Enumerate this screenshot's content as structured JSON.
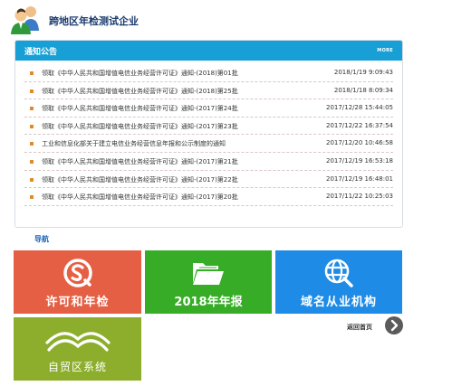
{
  "header": {
    "title": "跨地区年检测试企业",
    "user_icon": "user-group-icon"
  },
  "notice": {
    "title": "通知公告",
    "more_label": "MORE",
    "accent_color": "#18a0d6",
    "bullet_color": "#e08a2a",
    "items": [
      {
        "text": "领取《中华人民共和国增值电信业务经营许可证》通知-(2018)第01批",
        "date": "2018/1/19 9:09:43"
      },
      {
        "text": "领取《中华人民共和国增值电信业务经营许可证》通知-(2018)第25批",
        "date": "2018/1/18 8:09:34"
      },
      {
        "text": "领取《中华人民共和国增值电信业务经营许可证》通知-(2017)第24批",
        "date": "2017/12/28 15:44:05"
      },
      {
        "text": "领取《中华人民共和国增值电信业务经营许可证》通知-(2017)第23批",
        "date": "2017/12/22 16:37:54"
      },
      {
        "text": "工业和信息化部关于建立电信业务经营信息年报和公示制度的通知",
        "date": "2017/12/20 10:46:58"
      },
      {
        "text": "领取《中华人民共和国增值电信业务经营许可证》通知-(2017)第21批",
        "date": "2017/12/19 16:53:18"
      },
      {
        "text": "领取《中华人民共和国增值电信业务经营许可证》通知-(2017)第22批",
        "date": "2017/12/19 16:48:01"
      },
      {
        "text": "领取《中华人民共和国增值电信业务经营许可证》通知-(2017)第20批",
        "date": "2017/11/22 10:25:03"
      }
    ]
  },
  "nav": {
    "label": "导航",
    "tiles": [
      {
        "label": "许可和年检",
        "icon": "license-s-icon",
        "color": "#e55f44"
      },
      {
        "label": "2018年年报",
        "icon": "folder-icon",
        "color": "#37ad27"
      },
      {
        "label": "域名从业机构",
        "icon": "globe-icon",
        "color": "#1e8ce6"
      },
      {
        "label": "自贸区系统",
        "icon": "bridge-icon",
        "color": "#8cae2c"
      }
    ],
    "back_home": "返回首页",
    "back_icon": "arrow-right-icon"
  }
}
